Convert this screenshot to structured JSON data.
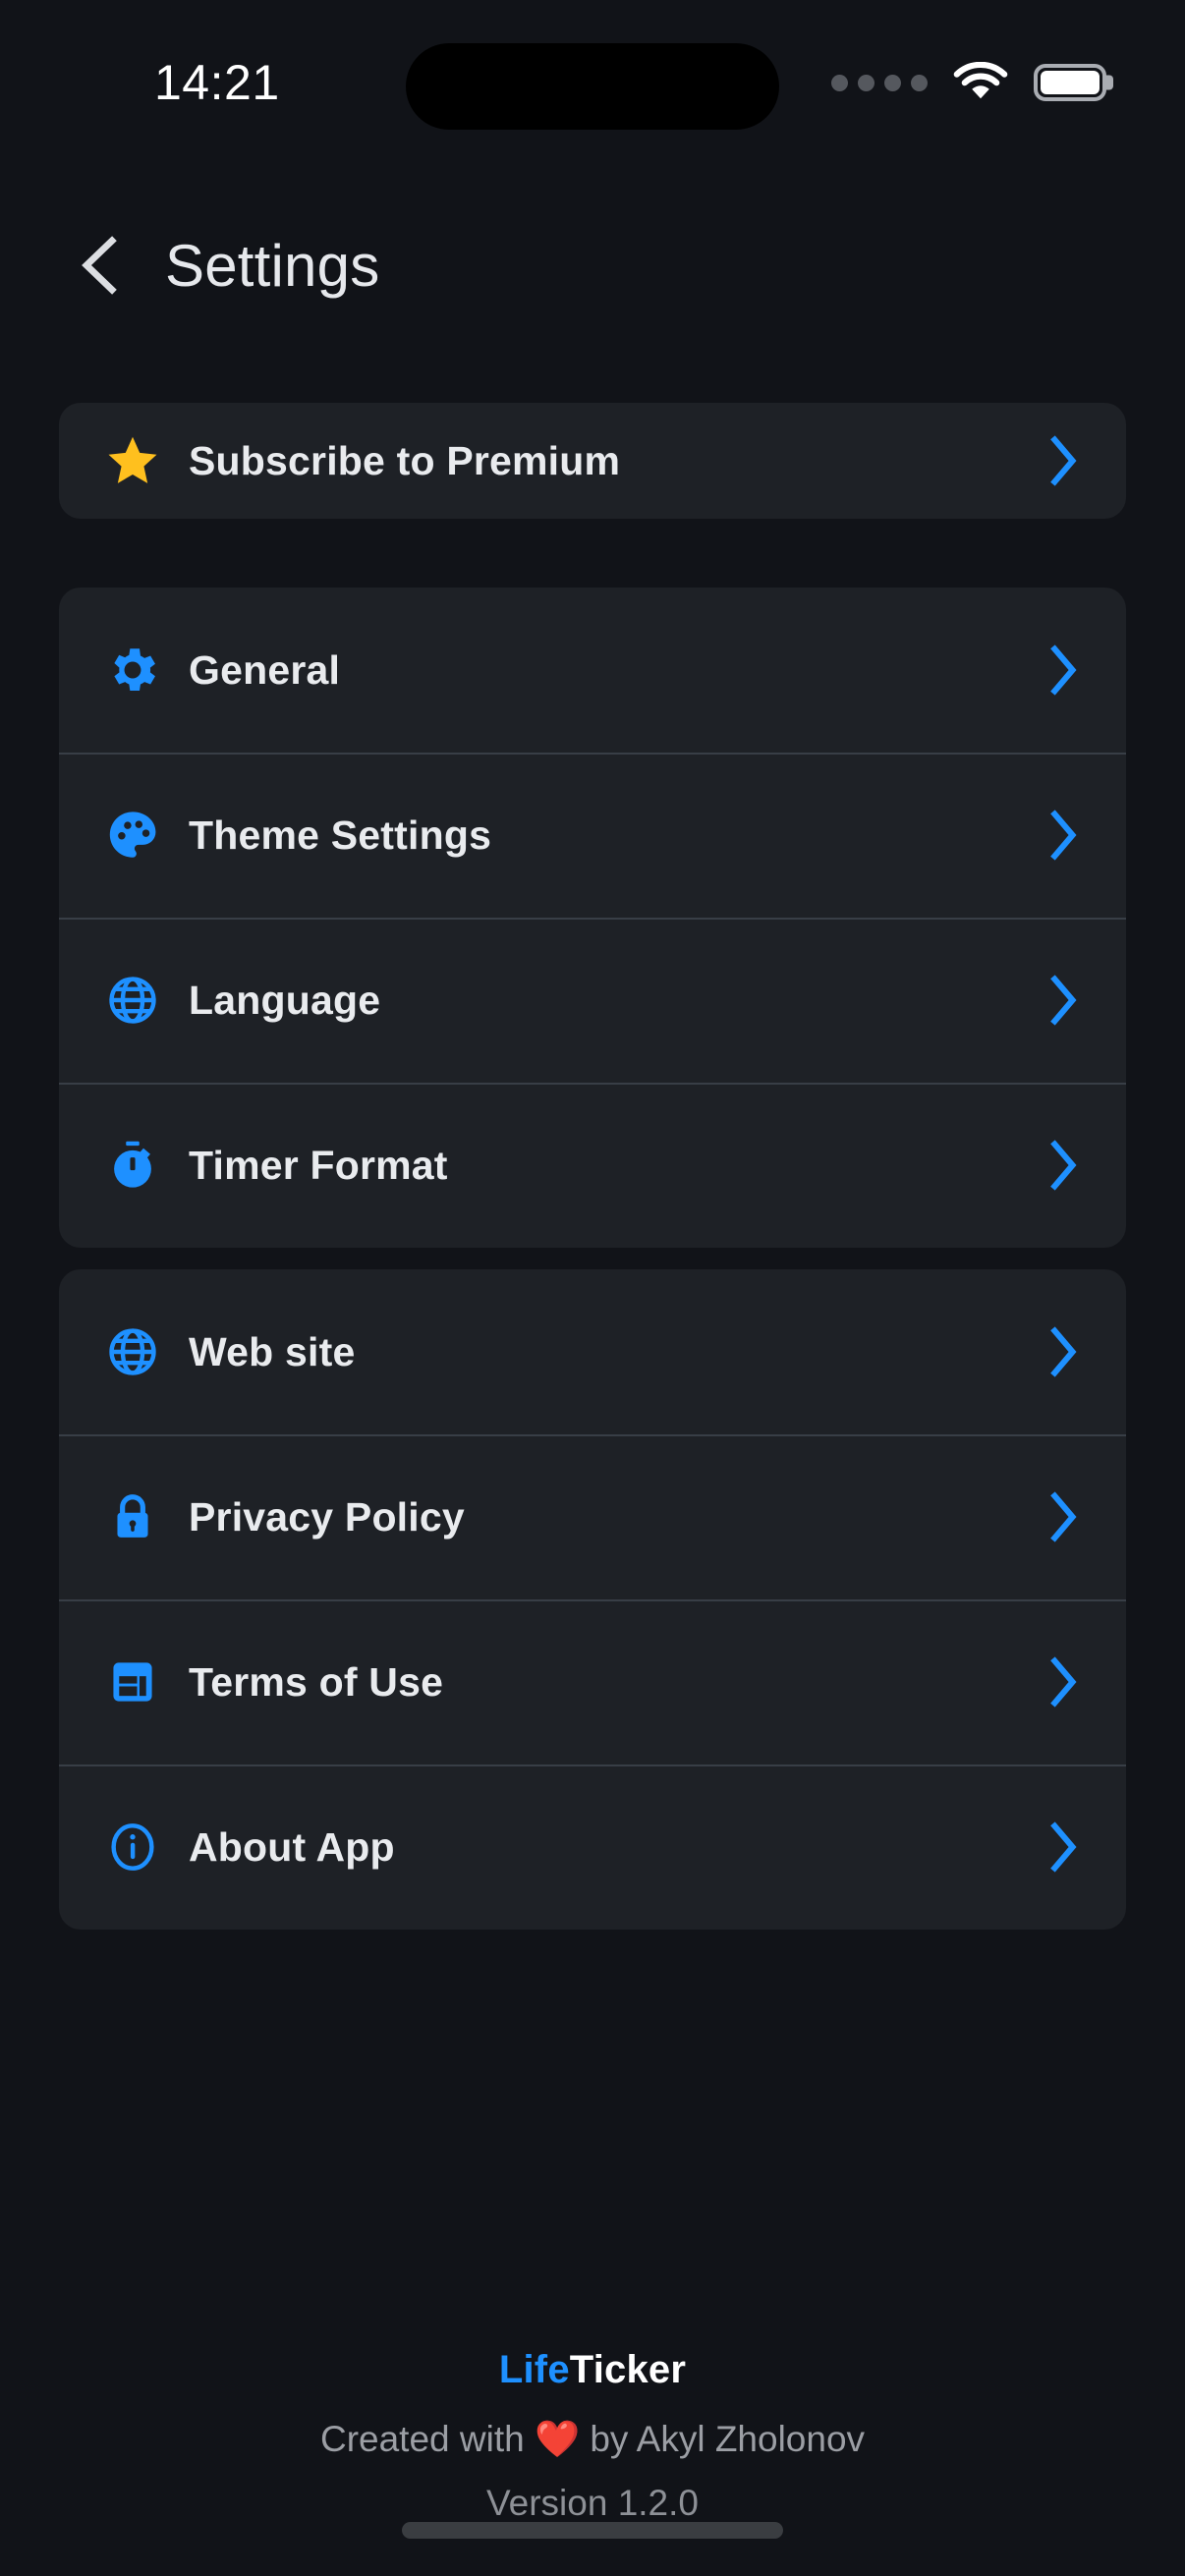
{
  "statusbar": {
    "time": "14:21",
    "signal_icon": "cellular-dots-icon",
    "wifi_icon": "wifi-icon",
    "battery_icon": "battery-full-icon"
  },
  "header": {
    "back_icon": "back-chevron-icon",
    "title": "Settings"
  },
  "colors": {
    "background": "#111318",
    "card": "#1e2126",
    "accent_blue": "#1e90ff",
    "star_gold": "#ffc01e",
    "separator": "#383e46",
    "label": "#e9ebee",
    "muted": "#9b9ea4",
    "heart_red": "#e0383c"
  },
  "groups": [
    {
      "name": "premium",
      "items": [
        {
          "label": "Subscribe to Premium",
          "icon": "star-icon",
          "chevron": "chevron-right-icon"
        }
      ]
    },
    {
      "name": "preferences",
      "items": [
        {
          "label": "General",
          "icon": "gear-icon",
          "chevron": "chevron-right-icon"
        },
        {
          "label": "Theme Settings",
          "icon": "palette-icon",
          "chevron": "chevron-right-icon"
        },
        {
          "label": "Language",
          "icon": "globe-icon",
          "chevron": "chevron-right-icon"
        },
        {
          "label": "Timer Format",
          "icon": "stopwatch-icon",
          "chevron": "chevron-right-icon"
        }
      ]
    },
    {
      "name": "information",
      "items": [
        {
          "label": "Web site",
          "icon": "globe-icon",
          "chevron": "chevron-right-icon"
        },
        {
          "label": "Privacy Policy",
          "icon": "lock-icon",
          "chevron": "chevron-right-icon"
        },
        {
          "label": "Terms of Use",
          "icon": "document-icon",
          "chevron": "chevron-right-icon"
        },
        {
          "label": "About App",
          "icon": "info-icon",
          "chevron": "chevron-right-icon"
        }
      ]
    }
  ],
  "footer": {
    "brand_first": "Life",
    "brand_second": "Ticker",
    "credit_prefix": "Created with ",
    "credit_heart": "❤️",
    "credit_suffix": " by Akyl Zholonov",
    "version": "Version 1.2.0"
  }
}
